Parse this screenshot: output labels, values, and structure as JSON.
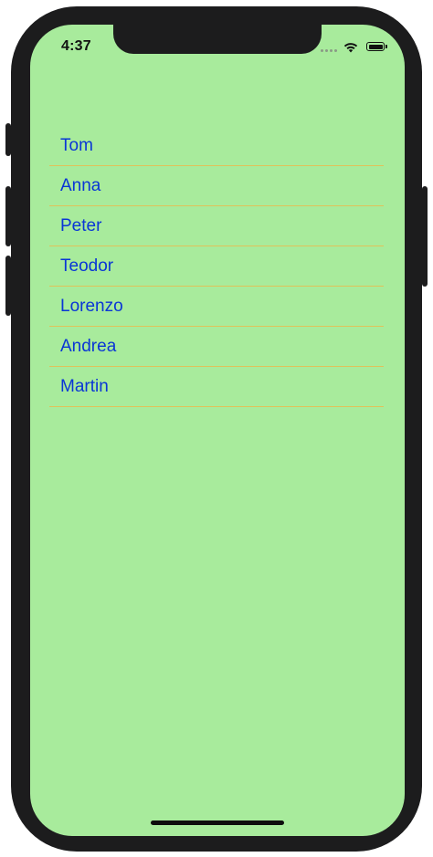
{
  "status_bar": {
    "time": "4:37"
  },
  "names": {
    "items": [
      {
        "label": "Tom"
      },
      {
        "label": "Anna"
      },
      {
        "label": "Peter"
      },
      {
        "label": "Teodor"
      },
      {
        "label": "Lorenzo"
      },
      {
        "label": "Andrea"
      },
      {
        "label": "Martin"
      }
    ]
  },
  "colors": {
    "background": "#a8eb9c",
    "text": "#0a36d6",
    "separator": "#e0c25a"
  },
  "icons": [
    "signal-icon",
    "wifi-icon",
    "battery-icon"
  ]
}
